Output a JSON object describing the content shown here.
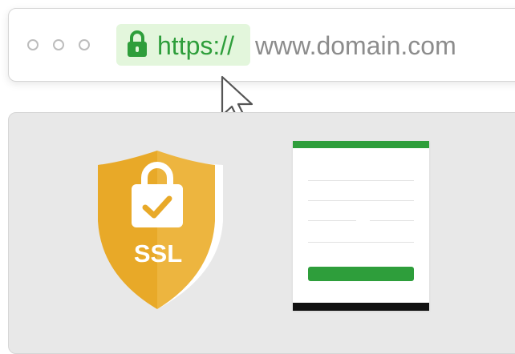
{
  "browser": {
    "window_dots": 3,
    "url": {
      "scheme": "https://",
      "host": "www.domain.com"
    }
  },
  "badge": {
    "label": "SSL"
  },
  "colors": {
    "secure_green": "#2e9e3b",
    "secure_chip_bg": "#e3f6dc",
    "shield_gold": "#e8a928",
    "host_gray": "#8c8c8c"
  },
  "icons": {
    "address_bar": "lock-icon",
    "pointer": "cursor-arrow-icon",
    "badge": "shield-padlock-check-icon"
  }
}
